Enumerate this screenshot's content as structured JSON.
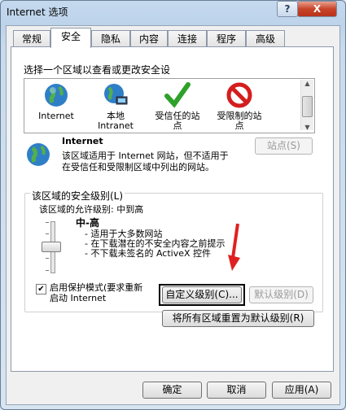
{
  "window": {
    "title": "Internet 选项",
    "help_label": "?",
    "close_label": "X"
  },
  "tabs": [
    "常规",
    "安全",
    "隐私",
    "内容",
    "连接",
    "程序",
    "高级"
  ],
  "security": {
    "instruction": "选择一个区域以查看或更改安全设",
    "zones": [
      {
        "label": "Internet",
        "icon": "globe-icon"
      },
      {
        "label": "本地\nIntranet",
        "icon": "intranet-globe-icon"
      },
      {
        "label": "受信任的站\n点",
        "icon": "green-check-icon"
      },
      {
        "label": "受限制的站\n点",
        "icon": "no-entry-icon"
      }
    ],
    "selected_zone": {
      "name": "Internet",
      "description": "该区域适用于 Internet 网站，但不适用于\n在受信任和受限制区域中列出的网站。",
      "sites_button": "站点(S)"
    },
    "level_group": {
      "legend": "该区域的安全级别(L)",
      "allowed_levels": "该区域的允许级别: 中到高",
      "level_name": "中-高",
      "bullets": [
        "- 适用于大多数网站",
        "- 在下载潜在的不安全内容之前提示",
        "- 不下载未签名的 ActiveX 控件"
      ],
      "protected_mode_label": "启用保护模式(要求重新\n启动 Internet",
      "protected_mode_checked": true,
      "custom_level_button": "自定义级别(C)...",
      "default_level_button": "默认级别(D)"
    },
    "reset_all_button": "将所有区域重置为默认级别(R)"
  },
  "footer": {
    "ok": "确定",
    "cancel": "取消",
    "apply": "应用(A)"
  }
}
